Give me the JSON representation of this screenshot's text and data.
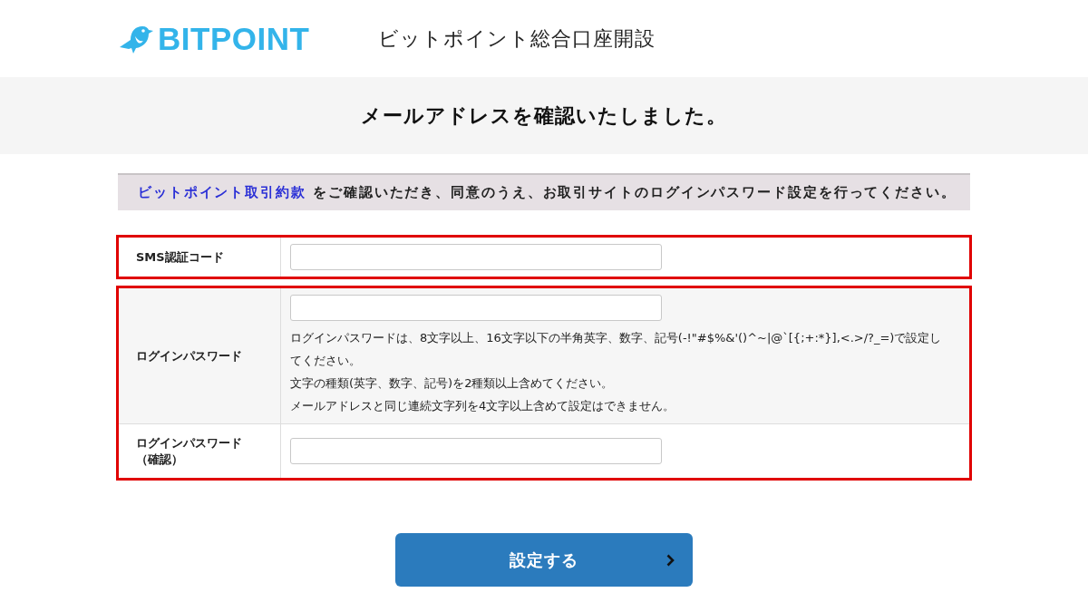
{
  "header": {
    "logo": "BITPOINT",
    "title": "ビットポイント総合口座開設"
  },
  "banner": {
    "heading": "メールアドレスを確認いたしました。"
  },
  "notice": {
    "link": "ビットポイント取引約款",
    "text": " をご確認いただき、同意のうえ、お取引サイトのログインパスワード設定を行ってください。"
  },
  "form": {
    "groups": [
      {
        "highlighted": true,
        "rows": [
          {
            "label": "SMS認証コード"
          }
        ]
      },
      {
        "highlighted": true,
        "rows": [
          {
            "label": "ログインパスワード",
            "notes": [
              "ログインパスワードは、8文字以上、16文字以下の半角英字、数字、記号(-!\"#$%&'()^~|@`[{;+:*}],<.>/?_=)で設定してください。",
              "文字の種類(英字、数字、記号)を2種類以上含めてください。",
              "メールアドレスと同じ連続文字列を4文字以上含めて設定はできません。"
            ]
          },
          {
            "label": "ログインパスワード",
            "sublabel": "（確認）"
          }
        ]
      }
    ]
  },
  "submit": {
    "label": "設定する"
  }
}
